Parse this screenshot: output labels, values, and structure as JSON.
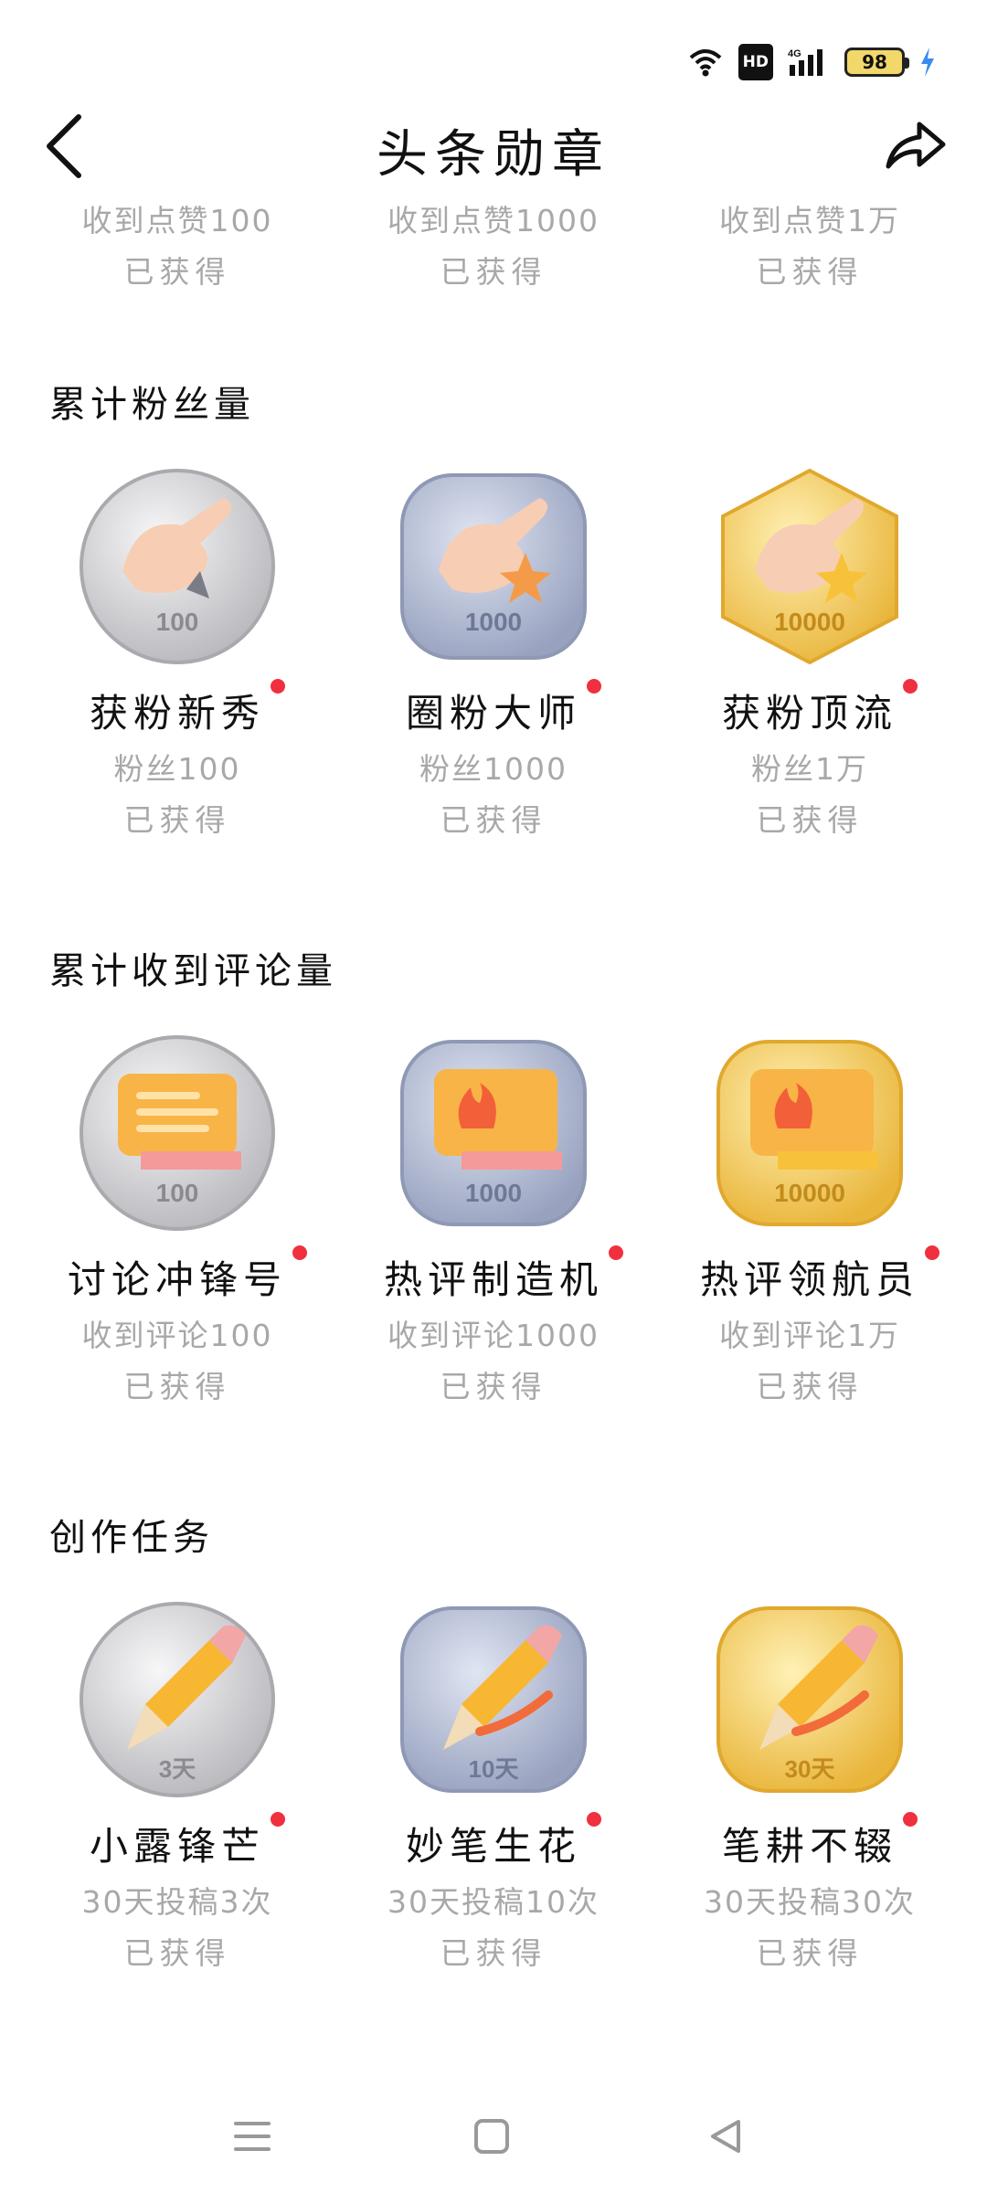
{
  "status": {
    "network": "4G",
    "hd": "HD",
    "battery": "98"
  },
  "header": {
    "title": "头条勋章"
  },
  "top_row": [
    {
      "desc": "收到点赞100",
      "status": "已获得"
    },
    {
      "desc": "收到点赞1000",
      "status": "已获得"
    },
    {
      "desc": "收到点赞1万",
      "status": "已获得"
    }
  ],
  "sections": [
    {
      "title": "累计粉丝量",
      "badges": [
        {
          "name": "获粉新秀",
          "desc": "粉丝100",
          "status": "已获得",
          "label": "100",
          "tier": "silver"
        },
        {
          "name": "圈粉大师",
          "desc": "粉丝1000",
          "status": "已获得",
          "label": "1000",
          "tier": "blue"
        },
        {
          "name": "获粉顶流",
          "desc": "粉丝1万",
          "status": "已获得",
          "label": "10000",
          "tier": "gold"
        }
      ]
    },
    {
      "title": "累计收到评论量",
      "badges": [
        {
          "name": "讨论冲锋号",
          "desc": "收到评论100",
          "status": "已获得",
          "label": "100",
          "tier": "silver"
        },
        {
          "name": "热评制造机",
          "desc": "收到评论1000",
          "status": "已获得",
          "label": "1000",
          "tier": "blue"
        },
        {
          "name": "热评领航员",
          "desc": "收到评论1万",
          "status": "已获得",
          "label": "10000",
          "tier": "gold"
        }
      ]
    },
    {
      "title": "创作任务",
      "badges": [
        {
          "name": "小露锋芒",
          "desc": "30天投稿3次",
          "status": "已获得",
          "label": "3天",
          "tier": "silver"
        },
        {
          "name": "妙笔生花",
          "desc": "30天投稿10次",
          "status": "已获得",
          "label": "10天",
          "tier": "blue"
        },
        {
          "name": "笔耕不辍",
          "desc": "30天投稿30次",
          "status": "已获得",
          "label": "30天",
          "tier": "gold"
        }
      ]
    }
  ],
  "colors": {
    "accent_dot": "#f0303e",
    "muted_text": "#a8a8a8",
    "gold": "#f3c64f",
    "silver": "#c9c9cc",
    "blue": "#a9b1c9"
  }
}
